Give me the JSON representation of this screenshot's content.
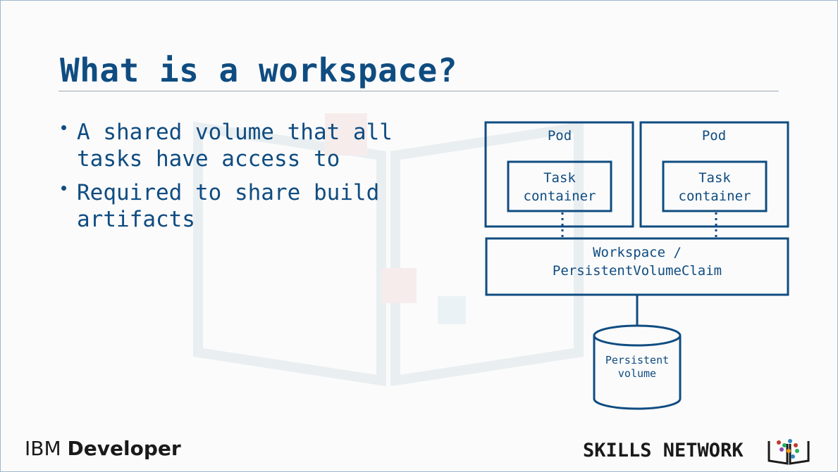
{
  "title": "What is a workspace?",
  "bullets": [
    {
      "line1": "A shared volume that all",
      "line2": "tasks have access to"
    },
    {
      "line1": "Required to share build",
      "line2": "artifacts"
    }
  ],
  "diagram": {
    "pod_left_label": "Pod",
    "pod_right_label": "Pod",
    "task_left": {
      "line1": "Task",
      "line2": "container"
    },
    "task_right": {
      "line1": "Task",
      "line2": "container"
    },
    "workspace": {
      "line1": "Workspace /",
      "line2": "PersistentVolumeClaim"
    },
    "persistent_volume": {
      "line1": "Persistent",
      "line2": "volume"
    }
  },
  "footer": {
    "brand_ibm": "IBM",
    "brand_developer": "Developer",
    "skills_network": "SKILLS NETWORK"
  },
  "colors": {
    "primary": "#0f4c81",
    "text_dark": "#1a1a1a"
  }
}
